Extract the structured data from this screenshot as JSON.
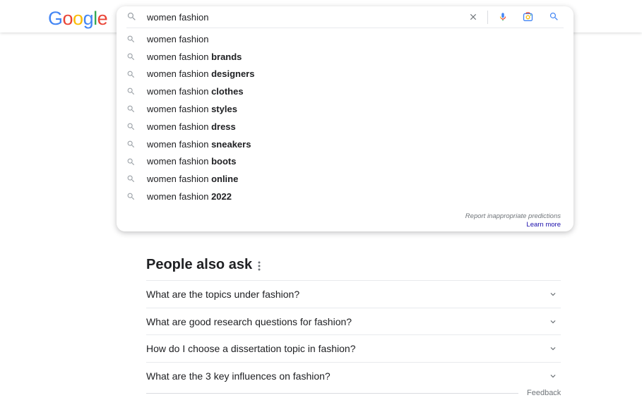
{
  "logo": {
    "letters": [
      "G",
      "o",
      "o",
      "g",
      "l",
      "e"
    ],
    "colors": [
      "#4285F4",
      "#EA4335",
      "#FBBC05",
      "#4285F4",
      "#34A853",
      "#EA4335"
    ]
  },
  "search": {
    "value": "women fashion",
    "placeholder": "",
    "icons": [
      "search-icon",
      "clear-icon",
      "mic-icon",
      "camera-lens-icon",
      "search-submit-icon"
    ]
  },
  "suggestions": [
    {
      "prefix": "women fashion",
      "bold": ""
    },
    {
      "prefix": "women fashion ",
      "bold": "brands"
    },
    {
      "prefix": "women fashion ",
      "bold": "designers"
    },
    {
      "prefix": "women fashion ",
      "bold": "clothes"
    },
    {
      "prefix": "women fashion ",
      "bold": "styles"
    },
    {
      "prefix": "women fashion ",
      "bold": "dress"
    },
    {
      "prefix": "women fashion ",
      "bold": "sneakers"
    },
    {
      "prefix": "women fashion ",
      "bold": "boots"
    },
    {
      "prefix": "women fashion ",
      "bold": "online"
    },
    {
      "prefix": "women fashion ",
      "bold": "2022"
    }
  ],
  "predictions": {
    "report": "Report inappropriate predictions",
    "learn_more": "Learn more"
  },
  "people_also_ask": {
    "title": "People also ask",
    "questions": [
      "What are the topics under fashion?",
      "What are good research questions for fashion?",
      "How do I choose a dissertation topic in fashion?",
      "What are the 3 key influences on fashion?"
    ]
  },
  "feedback": "Feedback",
  "colors": {
    "link": "#1a0dab",
    "text": "#202124",
    "muted": "#70757a",
    "accent_blue": "#4285F4"
  }
}
